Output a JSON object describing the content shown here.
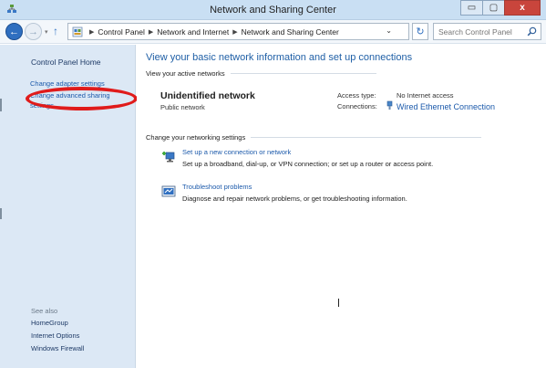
{
  "window": {
    "title": "Network and Sharing Center",
    "buttons": {
      "minimize": "▭",
      "maximize": "▢",
      "close": "x"
    }
  },
  "addressbar": {
    "breadcrumbs": [
      "Control Panel",
      "Network and Internet",
      "Network and Sharing Center"
    ],
    "search_placeholder": "Search Control Panel"
  },
  "sidebar": {
    "home": "Control Panel Home",
    "links": [
      "Change adapter settings",
      "Change advanced sharing",
      "settings"
    ],
    "see_also_label": "See also",
    "see_also": [
      "HomeGroup",
      "Internet Options",
      "Windows Firewall"
    ]
  },
  "main": {
    "headline": "View your basic network information and set up connections",
    "active_networks_header": "View your active networks",
    "network": {
      "name": "Unidentified network",
      "type": "Public network",
      "access_type_label": "Access type:",
      "access_type_value": "No Internet access",
      "connections_label": "Connections:",
      "connections_value": "Wired Ethernet Connection"
    },
    "settings_header": "Change your networking settings",
    "tasks": [
      {
        "link": "Set up a new connection or network",
        "desc": "Set up a broadband, dial-up, or VPN connection; or set up a router or access point."
      },
      {
        "link": "Troubleshoot problems",
        "desc": "Diagnose and repair network problems, or get troubleshooting information."
      }
    ],
    "cursor_text": "I"
  },
  "colors": {
    "link": "#1c5aab",
    "sidebar_bg": "#dce8f5",
    "titlebar_bg": "#c9dff3",
    "highlight": "#e01b1b"
  }
}
